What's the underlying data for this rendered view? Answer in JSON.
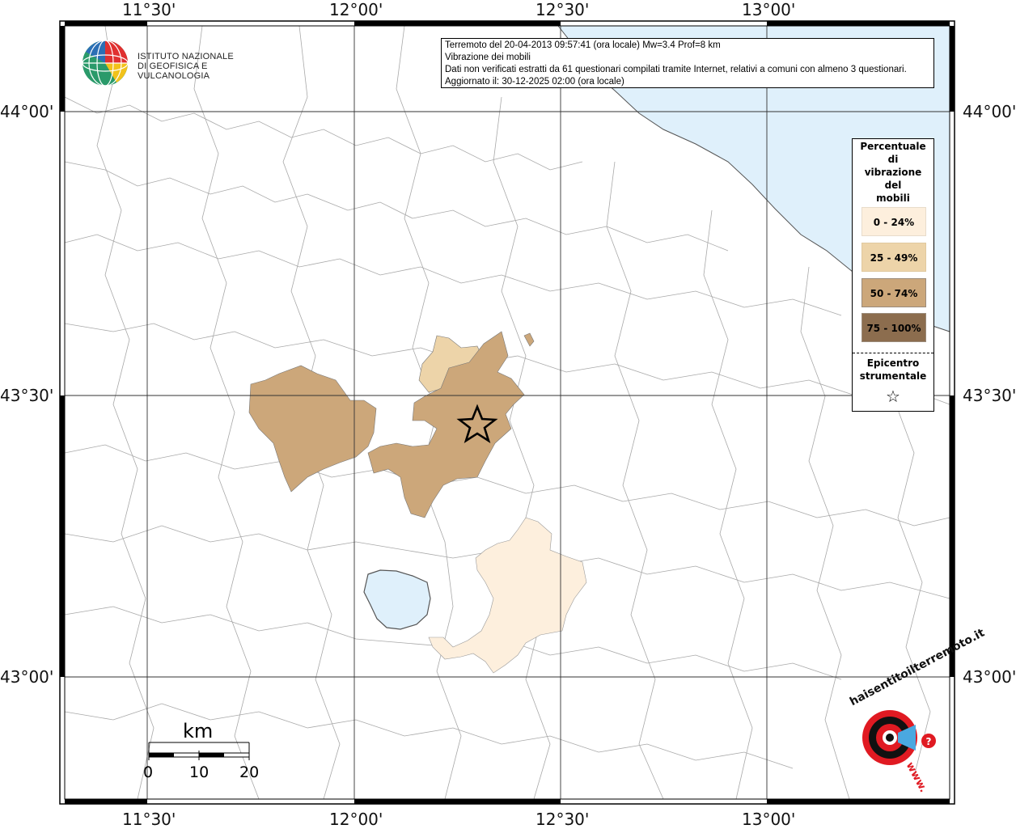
{
  "map": {
    "lon_ticks": [
      "11°30'",
      "12°00'",
      "12°30'",
      "13°00'"
    ],
    "lat_ticks": [
      "44°00'",
      "43°30'",
      "43°00'"
    ],
    "colors": {
      "sea": "#dff0fb",
      "lake": "#dff0fb",
      "class_0_24": "#fdefdd",
      "class_25_49": "#edd4a9",
      "class_50_74": "#cca77a",
      "class_75_100": "#8c6d4e",
      "border": "#9a9a9a",
      "grid": "#333333"
    }
  },
  "info_box": {
    "line1": "Terremoto del 20-04-2013 09:57:41 (ora locale) Mw=3.4 Prof=8 km",
    "line2": "Vibrazione dei mobili",
    "line3": "Dati non verificati estratti da 61 questionari compilati tramite Internet, relativi a comuni con almeno 3 questionari.",
    "line4": "Aggiornato il: 30-12-2025 02:00 (ora locale)"
  },
  "legend": {
    "title_lines": [
      "Percentuale",
      "di",
      "vibrazione",
      "del",
      "mobili"
    ],
    "items": [
      {
        "label": "0 - 24%",
        "color": "#fdefdd"
      },
      {
        "label": "25 - 49%",
        "color": "#edd4a9"
      },
      {
        "label": "50 - 74%",
        "color": "#cca77a"
      },
      {
        "label": "75 - 100%",
        "color": "#8c6d4e"
      }
    ],
    "epicenter_lines": [
      "Epicentro",
      "strumentale"
    ],
    "epicenter_symbol": "☆"
  },
  "logo_ingv": {
    "line1": "ISTITUTO NAZIONALE",
    "line2": "DI GEOFISICA E VULCANOLOGIA"
  },
  "scale_bar": {
    "unit": "km",
    "labels": [
      "0",
      "10",
      "20"
    ]
  },
  "logo_hsit": {
    "text": "haisentitoilterremoto.it",
    "www": "www.",
    "icon": "megaphone-icon"
  }
}
